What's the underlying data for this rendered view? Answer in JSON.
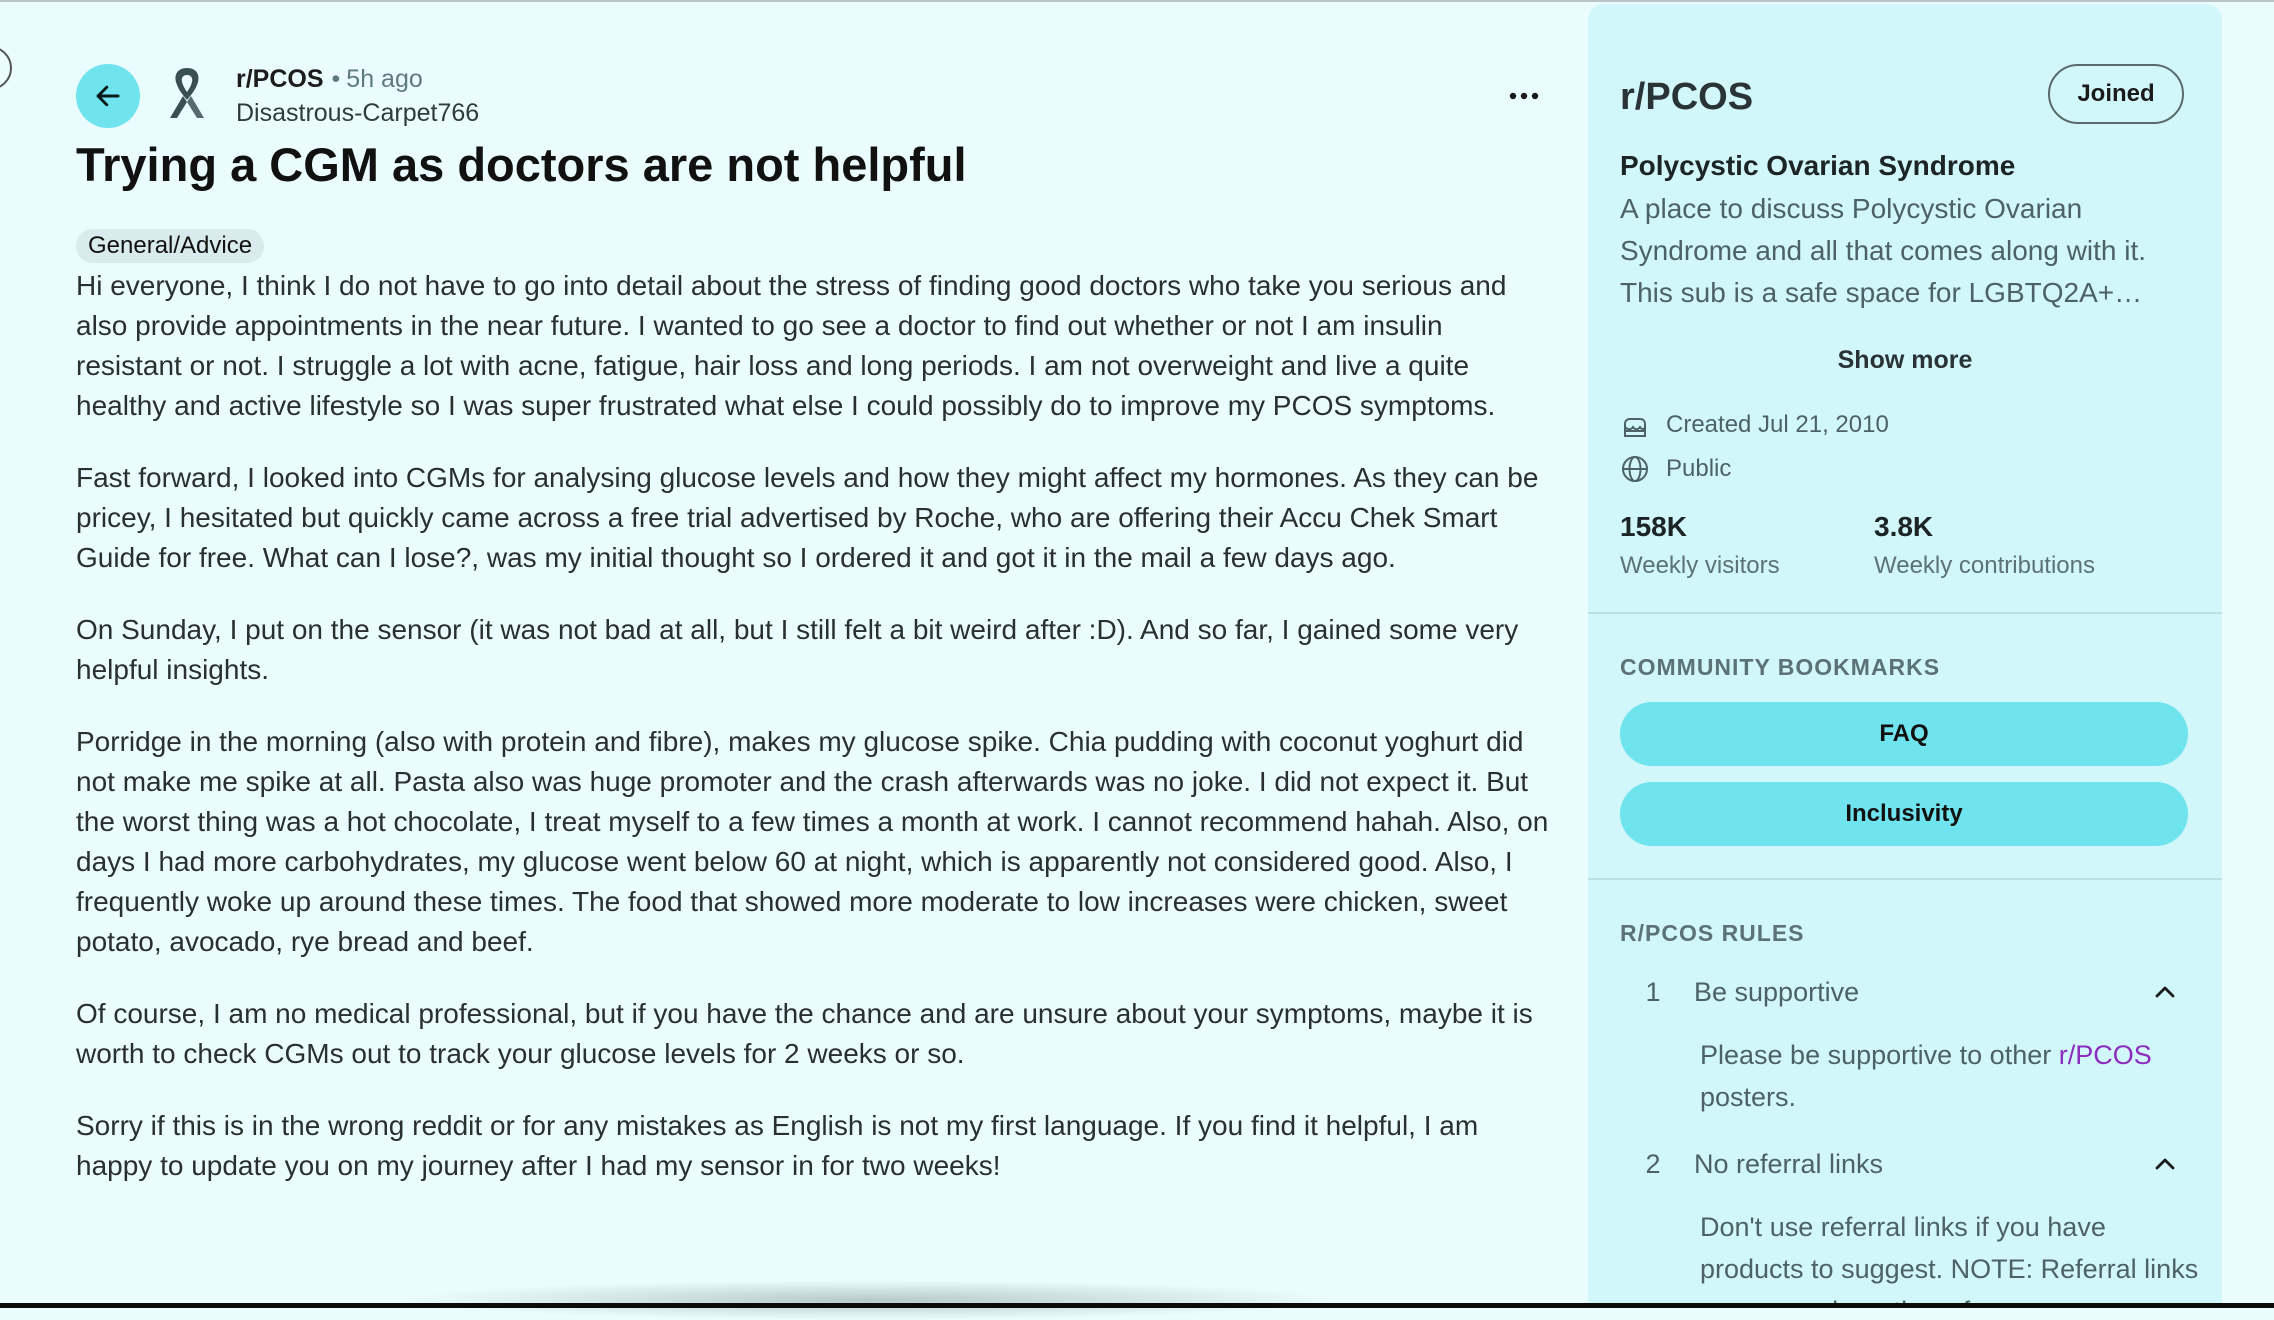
{
  "post": {
    "subreddit": "r/PCOS",
    "age": "5h ago",
    "author": "Disastrous-Carpet766",
    "title": "Trying a CGM as doctors are not helpful",
    "flair": "General/Advice",
    "paragraphs": [
      "Hi everyone, I think I do not have to go into detail about the stress of finding good doctors who take you serious and also provide appointments in the near future. I wanted to go see a doctor to find out whether or not I am insulin resistant or not. I struggle a lot with acne, fatigue, hair loss and long periods. I am not overweight and live a quite healthy and active lifestyle so I was super frustrated what else I could possibly do to improve my PCOS symptoms.",
      "Fast forward, I looked into CGMs for analysing glucose levels and how they might affect my hormones. As they can be pricey, I hesitated but quickly came across a free trial advertised by Roche, who are offering their Accu Chek Smart Guide for free. What can I lose?, was my initial thought so I ordered it and got it in the mail a few days ago.",
      "On Sunday, I put on the sensor (it was not bad at all, but I still felt a bit weird after :D). And so far, I gained some very helpful insights.",
      "Porridge in the morning (also with protein and fibre), makes my glucose spike. Chia pudding with coconut yoghurt did not make me spike at all. Pasta also was huge promoter and the crash afterwards was no joke. I did not expect it. But the worst thing was a hot chocolate, I treat myself to a few times a month at work. I cannot recommend hahah. Also, on days I had more carbohydrates, my glucose went below 60 at night, which is apparently not considered good. Also, I frequently woke up around these times. The food that showed more moderate to low increases were chicken, sweet potato, avocado, rye bread and beef.",
      "Of course, I am no medical professional, but if you have the chance and are unsure about your symptoms, maybe it is worth to check CGMs out to track your glucose levels for 2 weeks or so.",
      "Sorry if this is in the wrong reddit or for any mistakes as English is not my first language. If you find it helpful, I am happy to update you on my journey after I had my sensor in for two weeks!"
    ],
    "icons": {
      "back": "arrow-left-icon",
      "subreddit": "ribbon-icon",
      "more": "ellipsis-icon"
    }
  },
  "sidebar": {
    "name": "r/PCOS",
    "joined_label": "Joined",
    "title": "Polycystic Ovarian Syndrome",
    "description": "A place to discuss Polycystic Ovarian Syndrome and all that comes along with it. This sub is a safe space for LGBTQ2A+…",
    "show_more": "Show more",
    "created": "Created Jul 21, 2010",
    "visibility": "Public",
    "stats": [
      {
        "value": "158K",
        "label": "Weekly visitors"
      },
      {
        "value": "3.8K",
        "label": "Weekly contributions"
      }
    ],
    "bookmarks_heading": "COMMUNITY BOOKMARKS",
    "bookmarks": [
      "FAQ",
      "Inclusivity"
    ],
    "rules_heading": "R/PCOS RULES",
    "rules": [
      {
        "num": "1",
        "title": "Be supportive",
        "desc_pre": "Please be supportive to other ",
        "desc_link": "r/PCOS",
        "desc_post": " posters."
      },
      {
        "num": "2",
        "title": "No referral links",
        "desc": "Don't use referral links if you have products to suggest. NOTE: Referral links are ones where the referrer"
      }
    ]
  },
  "colors": {
    "background": "#eafcfd",
    "sidebar": "#d2f7fa",
    "accent": "#6fe4ee",
    "link": "#8c2dbd"
  }
}
